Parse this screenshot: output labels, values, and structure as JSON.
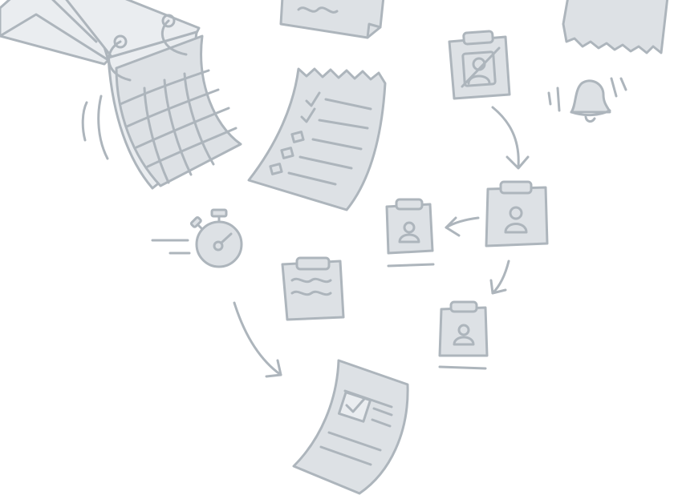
{
  "palette": {
    "stroke": "#adb5bc",
    "fill": "#dde1e5",
    "fill_light": "#eaedf0",
    "background": "#ffffff"
  },
  "icons": [
    "envelope-icon",
    "wavy-note-icon",
    "torn-receipt-icon",
    "calendar-icon",
    "checklist-receipt-icon",
    "crossed-out-person-clipboard-icon",
    "bell-icon",
    "person-clipboard-icon",
    "stopwatch-icon",
    "wavy-clipboard-icon",
    "checkbox-document-icon",
    "curved-arrow-icon"
  ]
}
